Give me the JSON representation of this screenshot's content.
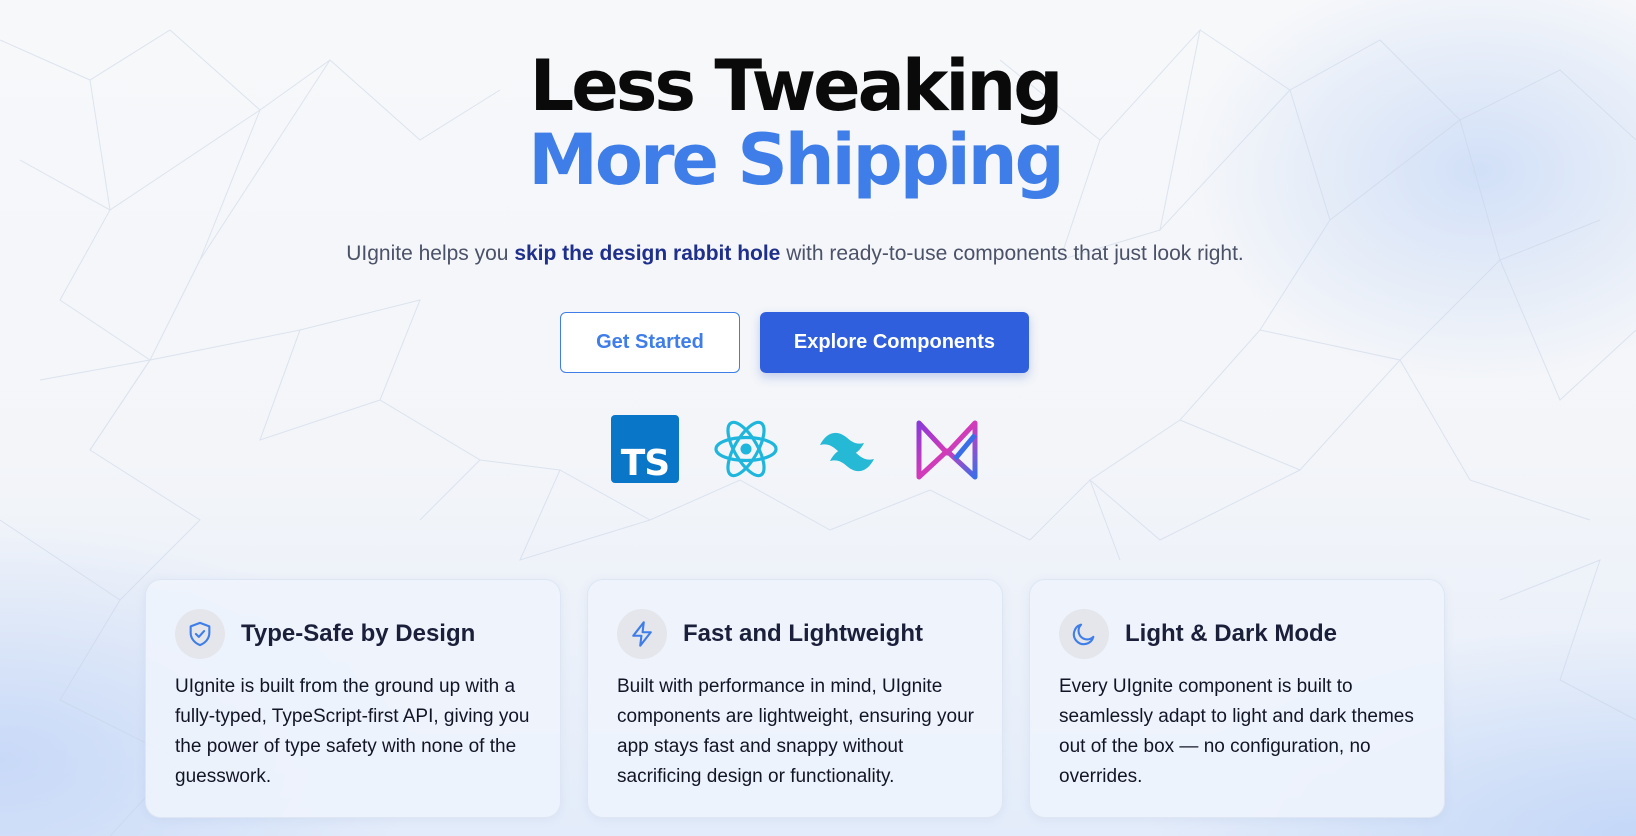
{
  "hero": {
    "title_line1": "Less Tweaking",
    "title_line2": "More Shipping",
    "tagline_prefix": "UIgnite helps you ",
    "tagline_bold": "skip the design rabbit hole",
    "tagline_suffix": " with ready-to-use components that just look right."
  },
  "buttons": {
    "get_started": "Get Started",
    "explore": "Explore Components"
  },
  "tech_icons": [
    {
      "icon": "typescript-logo-icon",
      "label": "TS"
    },
    {
      "icon": "react-logo-icon"
    },
    {
      "icon": "tailwind-logo-icon"
    },
    {
      "icon": "vitest-logo-icon"
    }
  ],
  "features": [
    {
      "icon": "shield-check-icon",
      "title": "Type-Safe by Design",
      "body": "UIgnite is built from the ground up with a fully-typed, TypeScript-first API, giving you the power of type safety with none of the guesswork."
    },
    {
      "icon": "lightning-icon",
      "title": "Fast and Lightweight",
      "body": "Built with performance in mind, UIgnite components are lightweight, ensuring your app stays fast and snappy without sacrificing design or functionality."
    },
    {
      "icon": "moon-icon",
      "title": "Light & Dark Mode",
      "body": "Every UIgnite component is built to seamlessly adapt to light and dark themes out of the box — no configuration, no overrides."
    }
  ],
  "colors": {
    "accent": "#3f7ee8",
    "primary_button": "#2f5fdc",
    "tagline_bold": "#1e2f8c",
    "ts_blue": "#0a76c8",
    "react_cyan": "#1fb6dd",
    "tailwind_cyan": "#25b9d6"
  }
}
